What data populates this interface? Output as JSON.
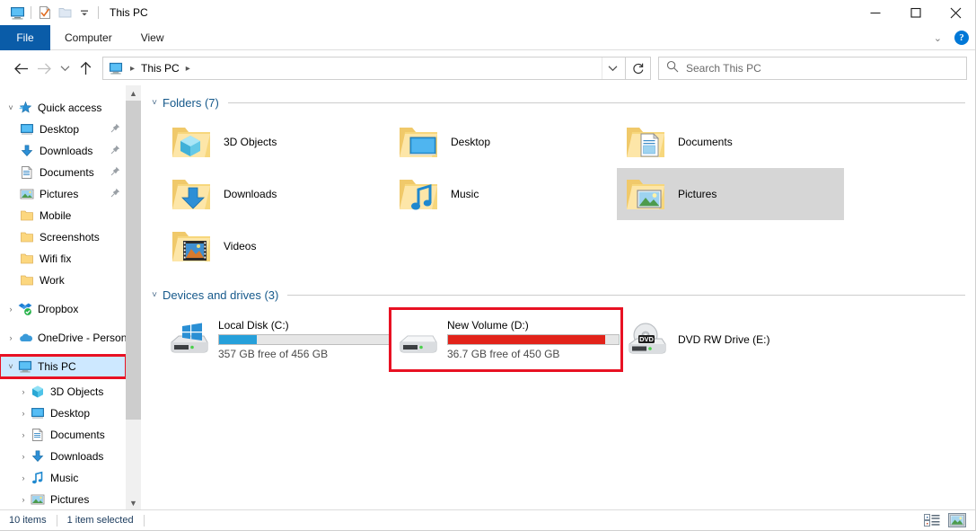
{
  "window": {
    "title": "This PC",
    "quick_access_toolbar": [
      {
        "name": "this-pc-icon",
        "label": "This PC"
      },
      {
        "name": "properties-icon",
        "label": "Properties"
      },
      {
        "name": "new-folder-icon",
        "label": "New folder"
      },
      {
        "name": "customize-dropdown-icon",
        "label": "Customize Quick Access Toolbar"
      }
    ],
    "controls": {
      "minimize": "Minimize",
      "maximize": "Maximize",
      "close": "Close"
    }
  },
  "ribbon": {
    "tabs": [
      {
        "label": "File",
        "active": true
      },
      {
        "label": "Computer",
        "active": false
      },
      {
        "label": "View",
        "active": false
      }
    ],
    "collapse_label": "Minimize the Ribbon",
    "help_label": "?"
  },
  "navbar": {
    "back_label": "Back",
    "forward_label": "Forward",
    "recent_label": "Recent locations",
    "up_label": "Up",
    "breadcrumbs": [
      "This PC"
    ],
    "address_dropdown_label": "Previous Locations",
    "refresh_label": "Refresh",
    "search": {
      "placeholder": "Search This PC",
      "value": ""
    }
  },
  "sidebar": {
    "items": [
      {
        "label": "Quick access",
        "icon": "quick-access-star-icon",
        "level": 0,
        "twisty": "expanded",
        "pinned": false
      },
      {
        "label": "Desktop",
        "icon": "desktop-icon",
        "level": 1,
        "twisty": "none",
        "pinned": true
      },
      {
        "label": "Downloads",
        "icon": "downloads-arrow-icon",
        "level": 1,
        "twisty": "none",
        "pinned": true
      },
      {
        "label": "Documents",
        "icon": "documents-icon",
        "level": 1,
        "twisty": "none",
        "pinned": true
      },
      {
        "label": "Pictures",
        "icon": "pictures-icon",
        "level": 1,
        "twisty": "none",
        "pinned": true
      },
      {
        "label": "Mobile",
        "icon": "folder-icon",
        "level": 1,
        "twisty": "none",
        "pinned": false
      },
      {
        "label": "Screenshots",
        "icon": "folder-icon",
        "level": 1,
        "twisty": "none",
        "pinned": false
      },
      {
        "label": "Wifi fix",
        "icon": "folder-icon",
        "level": 1,
        "twisty": "none",
        "pinned": false
      },
      {
        "label": "Work",
        "icon": "folder-icon",
        "level": 1,
        "twisty": "none",
        "pinned": false
      },
      {
        "label": "Dropbox",
        "icon": "dropbox-icon",
        "level": 0,
        "twisty": "collapsed",
        "pinned": false
      },
      {
        "label": "OneDrive - Person",
        "icon": "onedrive-cloud-icon",
        "level": 0,
        "twisty": "collapsed",
        "pinned": false
      },
      {
        "label": "This PC",
        "icon": "this-pc-icon",
        "level": 0,
        "twisty": "expanded",
        "pinned": false,
        "selected": true,
        "highlight": "red-box"
      },
      {
        "label": "3D Objects",
        "icon": "3d-objects-icon",
        "level": 1,
        "twisty": "collapsed",
        "pinned": false
      },
      {
        "label": "Desktop",
        "icon": "desktop-icon",
        "level": 1,
        "twisty": "collapsed",
        "pinned": false
      },
      {
        "label": "Documents",
        "icon": "documents-icon",
        "level": 1,
        "twisty": "collapsed",
        "pinned": false
      },
      {
        "label": "Downloads",
        "icon": "downloads-arrow-icon",
        "level": 1,
        "twisty": "collapsed",
        "pinned": false
      },
      {
        "label": "Music",
        "icon": "music-note-icon",
        "level": 1,
        "twisty": "collapsed",
        "pinned": false
      },
      {
        "label": "Pictures",
        "icon": "pictures-icon",
        "level": 1,
        "twisty": "collapsed",
        "pinned": false
      }
    ],
    "scroll_up_label": "Scroll up",
    "scroll_down_label": "Scroll down"
  },
  "main": {
    "groups": [
      {
        "title": "Folders (7)",
        "id": "folders",
        "twisty": "expanded",
        "items": [
          {
            "label": "3D Objects",
            "icon": "folder-3d-objects-icon",
            "selected": false
          },
          {
            "label": "Desktop",
            "icon": "folder-desktop-icon",
            "selected": false
          },
          {
            "label": "Documents",
            "icon": "folder-documents-icon",
            "selected": false
          },
          {
            "label": "Downloads",
            "icon": "folder-downloads-icon",
            "selected": false
          },
          {
            "label": "Music",
            "icon": "folder-music-icon",
            "selected": false
          },
          {
            "label": "Pictures",
            "icon": "folder-pictures-icon",
            "selected": true
          },
          {
            "label": "Videos",
            "icon": "folder-videos-icon",
            "selected": false
          }
        ]
      },
      {
        "title": "Devices and drives (3)",
        "id": "devices",
        "twisty": "expanded",
        "items": [
          {
            "label": "Local Disk (C:)",
            "icon": "hard-drive-windows-icon",
            "free_text": "357 GB free of 456 GB",
            "bar_percent": 22,
            "bar_color": "#26a0da",
            "has_bar": true,
            "highlight": "none"
          },
          {
            "label": "New Volume (D:)",
            "icon": "hard-drive-icon",
            "free_text": "36.7 GB free of 450 GB",
            "bar_percent": 92,
            "bar_color": "#e81123",
            "has_bar": true,
            "highlight": "red-box"
          },
          {
            "label": "DVD RW Drive (E:)",
            "icon": "dvd-drive-icon",
            "free_text": "",
            "bar_percent": 0,
            "bar_color": "",
            "has_bar": false,
            "highlight": "none"
          }
        ]
      }
    ]
  },
  "statusbar": {
    "item_count": "10 items",
    "selection": "1 item selected",
    "details_view_label": "Details view",
    "large_icons_view_label": "Large icons view"
  },
  "colors": {
    "accent_blue": "#0a5ca8",
    "group_header": "#16598b",
    "selection_blue": "#cde8ff",
    "highlight_red": "#e81123",
    "drive_bar_blue": "#26a0da",
    "drive_bar_red": "#e81123",
    "tile_selected_gray": "#d6d6d6"
  }
}
